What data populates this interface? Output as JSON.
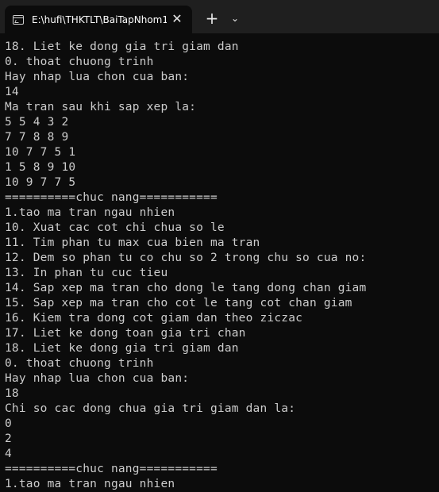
{
  "window": {
    "tab_title": "E:\\hufi\\THKTLT\\BaiTapNhom1",
    "tab_icon": "terminal-icon",
    "close_glyph": "✕",
    "new_tab_glyph": "+",
    "dropdown_glyph": "⌄"
  },
  "console": {
    "lines": [
      "18. Liet ke dong gia tri giam dan",
      "0. thoat chuong trinh",
      "Hay nhap lua chon cua ban:",
      "14",
      "Ma tran sau khi sap xep la:",
      "5 5 4 3 2",
      "7 7 8 8 9",
      "10 7 7 5 1",
      "1 5 8 9 10",
      "10 9 7 7 5",
      "==========chuc nang===========",
      "1.tao ma tran ngau nhien",
      "10. Xuat cac cot chi chua so le",
      "11. Tim phan tu max cua bien ma tran",
      "12. Dem so phan tu co chu so 2 trong chu so cua no:",
      "13. In phan tu cuc tieu",
      "14. Sap xep ma tran cho dong le tang dong chan giam",
      "15. Sap xep ma tran cho cot le tang cot chan giam",
      "16. Kiem tra dong cot giam dan theo ziczac",
      "17. Liet ke dong toan gia tri chan",
      "18. Liet ke dong gia tri giam dan",
      "0. thoat chuong trinh",
      "Hay nhap lua chon cua ban:",
      "18",
      "Chi so cac dong chua gia tri giam dan la:",
      "0",
      "2",
      "4",
      "==========chuc nang===========",
      "1.tao ma tran ngau nhien"
    ]
  }
}
